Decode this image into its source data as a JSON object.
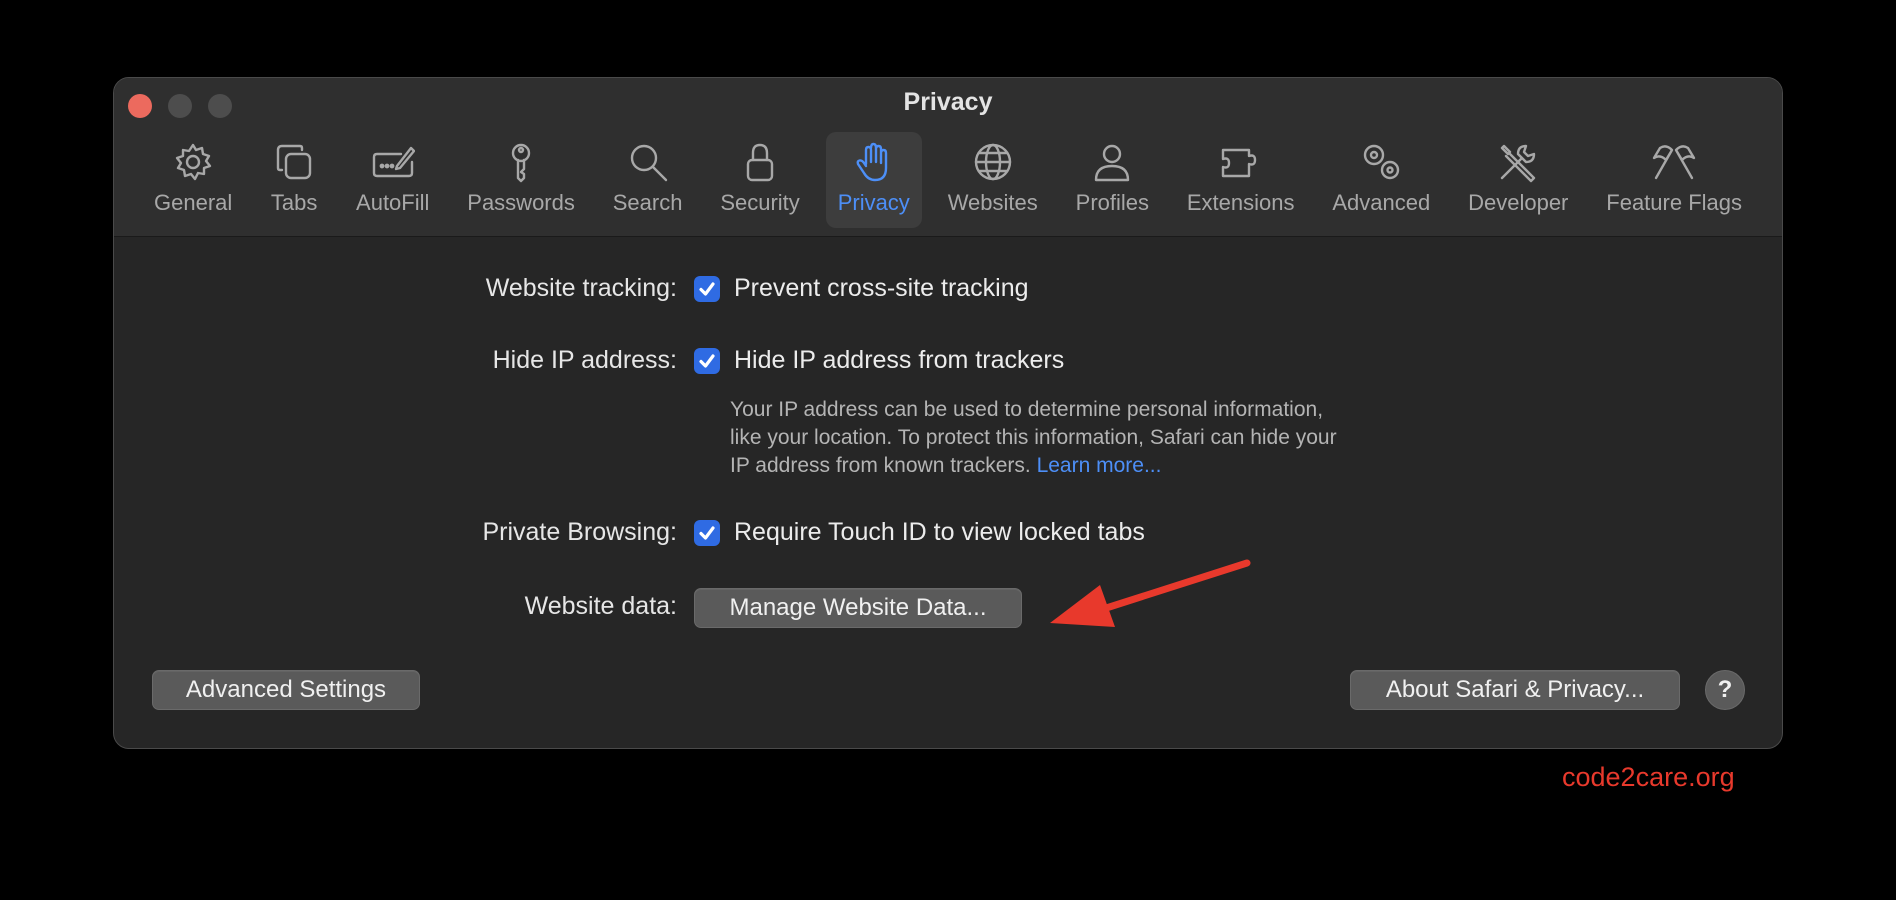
{
  "window": {
    "title": "Privacy"
  },
  "toolbar": {
    "items": [
      {
        "label": "General",
        "icon": "gear-icon"
      },
      {
        "label": "Tabs",
        "icon": "tabs-icon"
      },
      {
        "label": "AutoFill",
        "icon": "autofill-icon"
      },
      {
        "label": "Passwords",
        "icon": "key-icon"
      },
      {
        "label": "Search",
        "icon": "magnifier-icon"
      },
      {
        "label": "Security",
        "icon": "lock-icon"
      },
      {
        "label": "Privacy",
        "icon": "hand-icon",
        "selected": true
      },
      {
        "label": "Websites",
        "icon": "globe-icon"
      },
      {
        "label": "Profiles",
        "icon": "person-icon"
      },
      {
        "label": "Extensions",
        "icon": "puzzle-icon"
      },
      {
        "label": "Advanced",
        "icon": "gears-icon"
      },
      {
        "label": "Developer",
        "icon": "tools-icon"
      },
      {
        "label": "Feature Flags",
        "icon": "flags-icon"
      }
    ],
    "active_color": "#4d8ff7"
  },
  "settings": {
    "website_tracking": {
      "label": "Website tracking:",
      "checkbox_text": "Prevent cross-site tracking",
      "checked": true
    },
    "hide_ip": {
      "label": "Hide IP address:",
      "checkbox_text": "Hide IP address from trackers",
      "checked": true,
      "desc_line1": "Your IP address can be used to determine personal information,",
      "desc_line2": "like your location. To protect this information, Safari can hide your",
      "desc_line3": "IP address from known trackers.",
      "learn_more": "Learn more..."
    },
    "private_browsing": {
      "label": "Private Browsing:",
      "checkbox_text": "Require Touch ID to view locked tabs",
      "checked": true
    },
    "website_data": {
      "label": "Website data:",
      "button": "Manage Website Data..."
    }
  },
  "footer": {
    "advanced_settings": "Advanced Settings",
    "about": "About Safari & Privacy...",
    "help": "?"
  },
  "annotation": {
    "watermark": "code2care.org",
    "arrow_color": "#e8392c"
  },
  "colors": {
    "checkbox": "#2f6be3",
    "close_button": "#ec6a5e"
  }
}
